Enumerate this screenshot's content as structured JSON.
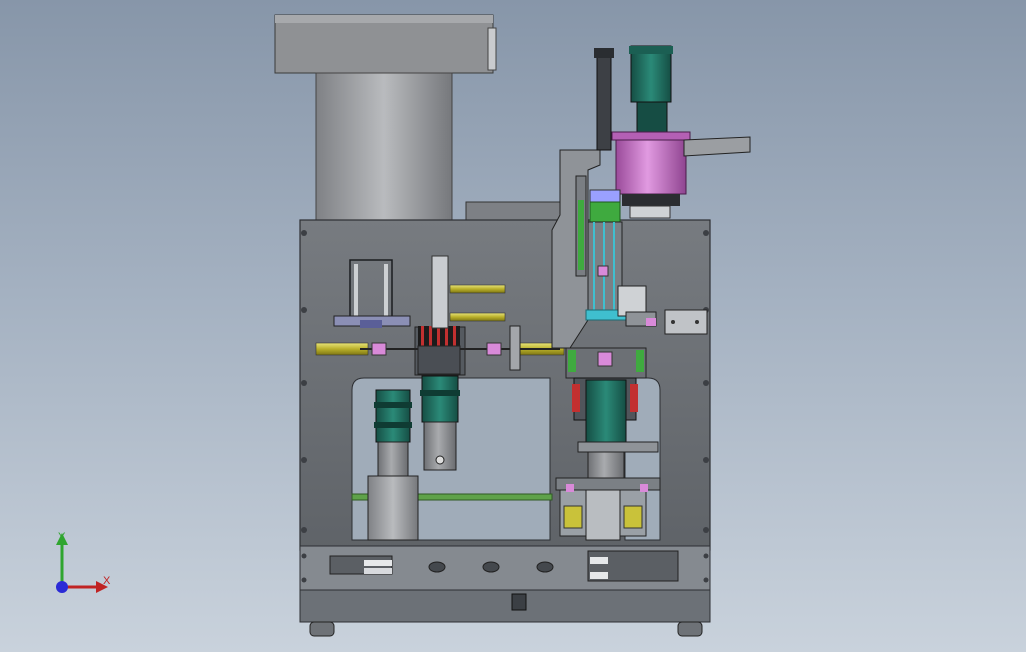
{
  "viewport": {
    "background_top": "#8796a9",
    "background_bottom": "#c9d2dc"
  },
  "triad": {
    "y_label": "Y",
    "x_label": "X",
    "y_color": "#2fa52f",
    "x_color": "#c02323",
    "z_color": "#2a2ad6"
  },
  "colors": {
    "frame": "#6a6f76",
    "hopper": "#8d8f92",
    "motor_green": "#1f6f60",
    "magenta": "#c06fc0",
    "brass": "#c9c23a",
    "accent_green": "#3faa3f",
    "cyan": "#3fbfcf",
    "red": "#c23030"
  }
}
